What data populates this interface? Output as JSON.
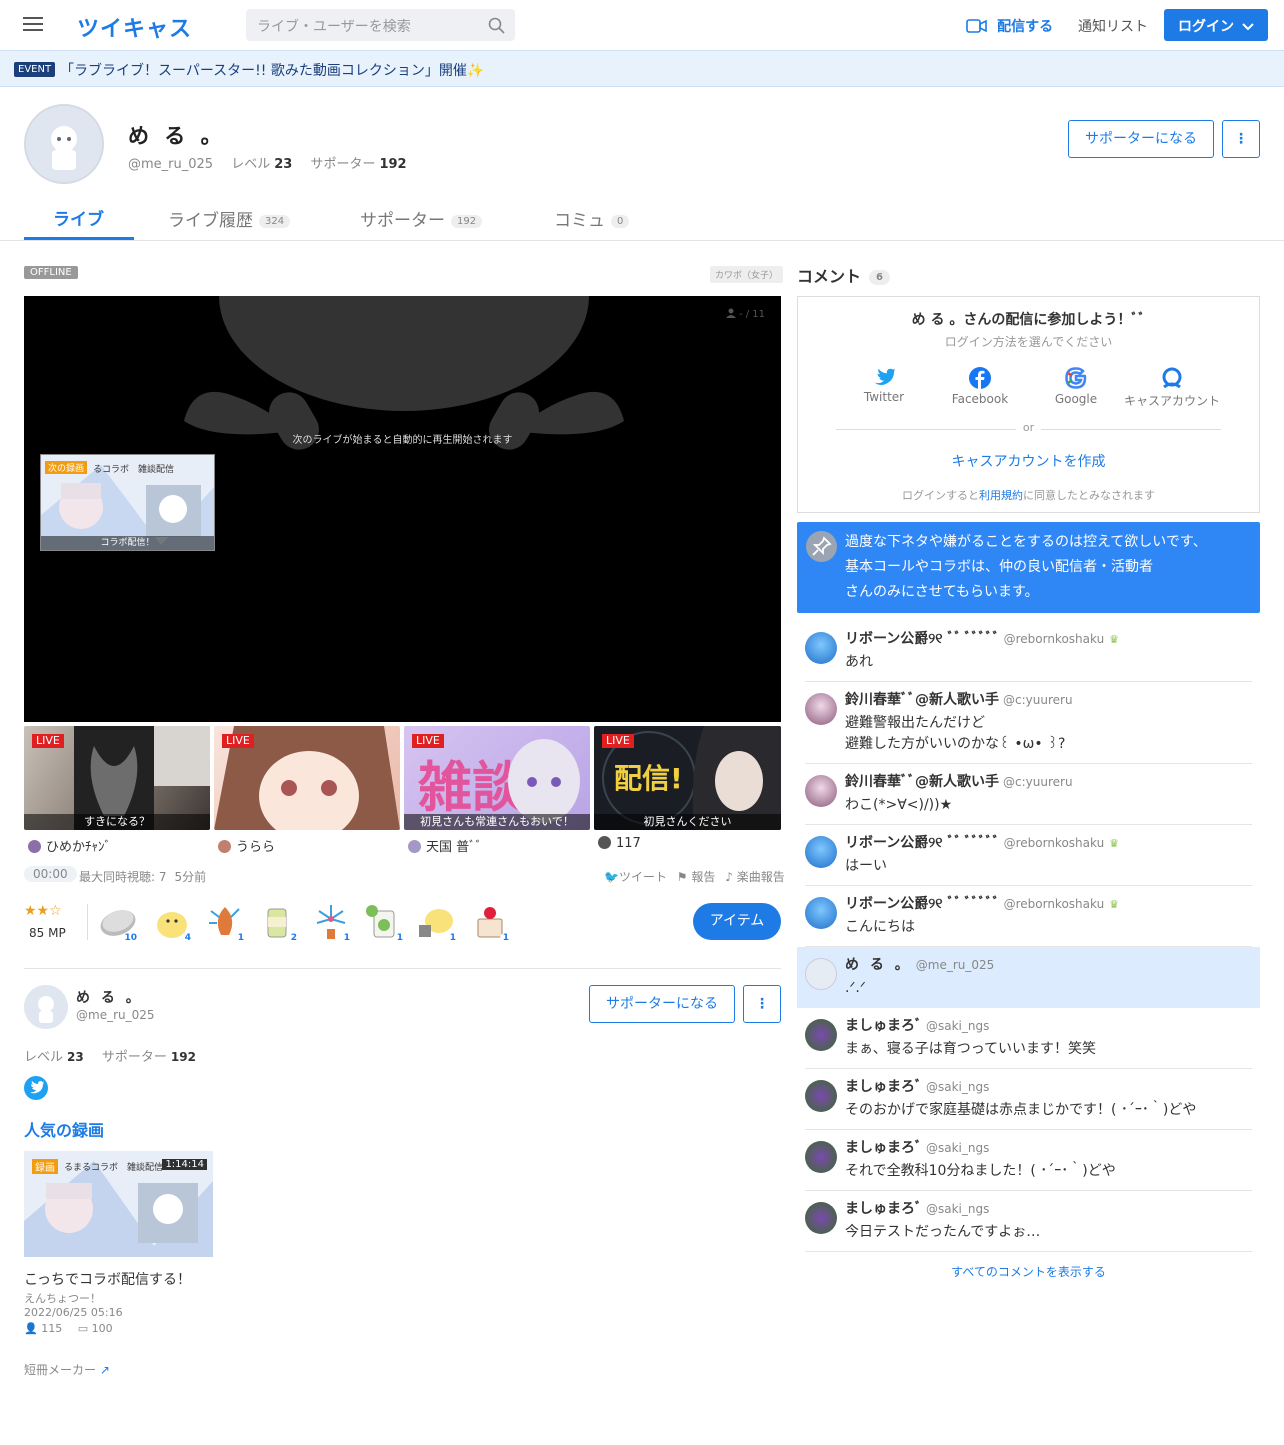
{
  "header": {
    "logo": "ツイキャス",
    "search_placeholder": "ライブ・ユーザーを検索",
    "broadcast": "配信する",
    "notify": "通知リスト",
    "login": "ログイン"
  },
  "event": {
    "badge": "EVENT",
    "text": "「ラブライブ！スーパースター!! 歌みた動画コレクション」開催✨"
  },
  "profile": {
    "name": "め る 。",
    "handle": "@me_ru_025",
    "level_label": "レベル",
    "level": "23",
    "supporter_label": "サポーター",
    "supporters": "192",
    "support_button": "サポーターになる",
    "more": "⋮"
  },
  "tabs": [
    {
      "label": "ライブ",
      "count": ""
    },
    {
      "label": "ライブ履歴",
      "count": "324"
    },
    {
      "label": "サポーター",
      "count": "192"
    },
    {
      "label": "コミュ",
      "count": "0"
    }
  ],
  "player": {
    "status": "OFFLINE",
    "category": "カワボ（女子）",
    "viewers": "- / 11",
    "message": "次のライブが始まると自動的に再生開始されます",
    "next_badge": "次の録画",
    "next_title": "るコラボ　雑談配信",
    "next_caption": "コラボ配信！"
  },
  "lives": [
    {
      "badge": "LIVE",
      "caption": "すきになる？",
      "name": "ひめかﾁｬﾝﾞ"
    },
    {
      "badge": "LIVE",
      "caption": "",
      "name": "うらら"
    },
    {
      "badge": "LIVE",
      "caption": "初見さんも常連さんもおいで！",
      "name": "天国 普ﾞﾞ"
    },
    {
      "badge": "LIVE",
      "caption": "初見さんください",
      "name": "117"
    }
  ],
  "stats": {
    "time": "00:00",
    "max_viewers": "最大同時視聴: 7",
    "ago": "5分前",
    "tweet": "ツイート",
    "report": "報告",
    "song_report": "楽曲報告"
  },
  "items": {
    "mp": "85 MP",
    "counts": [
      "10",
      "4",
      "1",
      "2",
      "1",
      "1",
      "1",
      "1"
    ],
    "button": "アイテム"
  },
  "profile2": {
    "name": "め る 。",
    "handle": "@me_ru_025",
    "level_label": "レベル",
    "level": "23",
    "supporter_label": "サポーター",
    "supporters": "192",
    "support_button": "サポーターになる",
    "more": "⋮"
  },
  "popular": {
    "title": "人気の録画",
    "badge": "録画",
    "duration": "1:14:14",
    "thumb_title": "るまるコラボ　雑談配信",
    "video_title": "こっちでコラボ配信する！",
    "sub": "えんちょつー！",
    "date": "2022/06/25 05:16",
    "views": "115",
    "comments": "100",
    "tanzaku": "短冊メーカー"
  },
  "comments_panel": {
    "title": "コメント",
    "count": "6",
    "join_title": "め る 。さんの配信に参加しよう！ﾞﾞ",
    "join_sub": "ログイン方法を選んでください",
    "socials": [
      "Twitter",
      "Facebook",
      "Google",
      "キャスアカウント"
    ],
    "or": "or",
    "create": "キャスアカウントを作成",
    "terms_pre": "ログインすると",
    "terms_link": "利用規約",
    "terms_post": "に同意したとみなされます",
    "pinned": [
      "過度な下ネタや嫌がることをするのは控えて欲しいです、",
      "基本コールやコラボは、仲の良い配信者・活動者",
      "さんのみにさせてもらいます。"
    ],
    "show_all": "すべてのコメントを表示する"
  },
  "comments": [
    {
      "name": "リボーン公爵୨୧ ﾞﾞ ﾞﾞﾞﾞﾞ",
      "handle": "@rebornkoshaku",
      "text": "あれ",
      "text2": ""
    },
    {
      "name": "鈴川春華ﾞﾞ@新人歌い手",
      "handle": "@c:yuureru",
      "text": "避難警報出たんだけど",
      "text2": "避難した方がいいのかな꒰ •ω• ꒱?"
    },
    {
      "name": "鈴川春華ﾞﾞ@新人歌い手",
      "handle": "@c:yuureru",
      "text": "わこ(*>∀<)/))★",
      "text2": ""
    },
    {
      "name": "リボーン公爵୨୧ ﾞﾞ ﾞﾞﾞﾞﾞ",
      "handle": "@rebornkoshaku",
      "text": "はーい",
      "text2": ""
    },
    {
      "name": "リボーン公爵୨୧ ﾞﾞ ﾞﾞﾞﾞﾞ",
      "handle": "@rebornkoshaku",
      "text": "こんにちは",
      "text2": ""
    },
    {
      "name": "め る 。",
      "handle": "@me_ru_025",
      "text": ".ᐟ.ᐟ",
      "text2": ""
    },
    {
      "name": "ましゅまろﾞ",
      "handle": "@saki_ngs",
      "text": "まぁ、寝る子は育つっていいます！笑笑",
      "text2": ""
    },
    {
      "name": "ましゅまろﾞ",
      "handle": "@saki_ngs",
      "text": "そのおかげで家庭基礎は赤点まじかです！( ･´ｰ･｀)どや",
      "text2": ""
    },
    {
      "name": "ましゅまろﾞ",
      "handle": "@saki_ngs",
      "text": "それで全教科10分ねました！( ･´ｰ･｀)どや",
      "text2": ""
    },
    {
      "name": "ましゅまろﾞ",
      "handle": "@saki_ngs",
      "text": "今日テストだったんですよぉ…",
      "text2": ""
    }
  ],
  "colors": {
    "accent": "#1e7be6",
    "pinned": "#2f86f5",
    "live": "#e02020",
    "badge_orange": "#f39c12"
  }
}
